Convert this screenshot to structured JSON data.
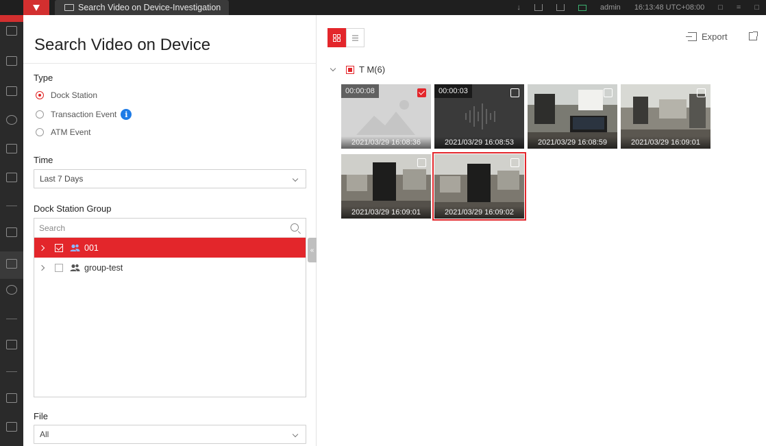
{
  "window": {
    "tab_title": "Search Video on Device-Investigation",
    "user": "admin",
    "clock": "16:13:48 UTC+08:00"
  },
  "panel": {
    "title": "Search Video on Device",
    "type_label": "Type",
    "type_options": [
      {
        "label": "Dock Station",
        "selected": true
      },
      {
        "label": "Transaction Event",
        "selected": false
      },
      {
        "label": "ATM Event",
        "selected": false
      }
    ],
    "time_label": "Time",
    "time_value": "Last 7 Days",
    "group_label": "Dock Station Group",
    "group_search_placeholder": "Search",
    "groups": [
      {
        "label": "001",
        "checked": true,
        "selected": true
      },
      {
        "label": "group-test",
        "checked": false,
        "selected": false
      }
    ],
    "file_label": "File",
    "file_value": "All"
  },
  "toolbar": {
    "export_label": "Export"
  },
  "device": {
    "label": "T M(6)"
  },
  "videos": [
    {
      "duration": "00:00:08",
      "timestamp": "2021/03/29 16:08:36",
      "checked": true,
      "kind": "placeholder"
    },
    {
      "duration": "00:00:03",
      "timestamp": "2021/03/29 16:08:53",
      "checked": false,
      "kind": "audio"
    },
    {
      "duration": "",
      "timestamp": "2021/03/29 16:08:59",
      "checked": false,
      "kind": "office"
    },
    {
      "duration": "",
      "timestamp": "2021/03/29 16:09:01",
      "checked": false,
      "kind": "office"
    },
    {
      "duration": "",
      "timestamp": "2021/03/29 16:09:01",
      "checked": false,
      "kind": "office"
    },
    {
      "duration": "",
      "timestamp": "2021/03/29 16:09:02",
      "checked": false,
      "kind": "office",
      "highlighted": true
    }
  ],
  "colors": {
    "accent": "#e3262b",
    "info": "#1e7be6"
  }
}
